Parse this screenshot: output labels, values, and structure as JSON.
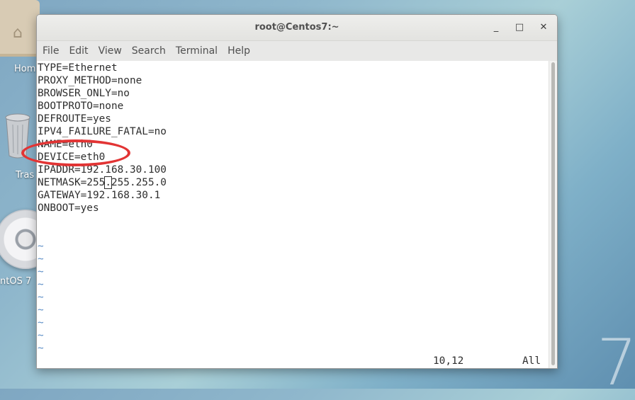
{
  "desktop": {
    "icons": [
      {
        "label": "Hom",
        "icon": "home-folder-icon"
      },
      {
        "label": "Tras",
        "icon": "trash-icon"
      },
      {
        "label": "ntOS 7",
        "icon": "disc-icon"
      }
    ],
    "decoration": "7"
  },
  "window": {
    "title": "root@Centos7:~",
    "controls": {
      "minimize": "_",
      "maximize": "□",
      "close": "✕"
    }
  },
  "menu": [
    "File",
    "Edit",
    "View",
    "Search",
    "Terminal",
    "Help"
  ],
  "terminal": {
    "lines": [
      "TYPE=Ethernet",
      "PROXY_METHOD=none",
      "BROWSER_ONLY=no",
      "BOOTPROTO=none",
      "DEFROUTE=yes",
      "IPV4_FAILURE_FATAL=no",
      "NAME=eth0",
      "DEVICE=eth0",
      "IPADDR=192.168.30.100",
      "NETMASK=255",
      ".",
      "255.255.0",
      "GATEWAY=192.168.30.1",
      "ONBOOT=yes"
    ],
    "tilde": "~",
    "status_position": "10,12",
    "status_view": "All"
  },
  "annotation_color": "#e23434"
}
